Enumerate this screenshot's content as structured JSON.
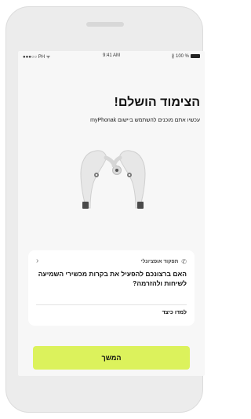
{
  "status_bar": {
    "carrier": "●●●○○ PH ᯤ",
    "time": "9:41 AM",
    "bluetooth": "∦",
    "battery": "100 %"
  },
  "screen": {
    "title": "הצימוד הושלם!",
    "subtitle": "עכשיו אתם מוכנים להשתמש ביישום myPhonak"
  },
  "card": {
    "label": "תפקוד אופציונלי",
    "question": "האם ברצונכם להפעיל את בקרות מכשירי השמיעה לשיחות ולהזרמה?",
    "link": "למדו כיצד",
    "chevron": "›"
  },
  "continue_button": {
    "label": "המשך"
  },
  "icons": {
    "card_icon": "phone-call-icon",
    "card_chevron": "chevron-icon",
    "illustration": "hearing-aids"
  },
  "colors": {
    "accent": "#dcf25c",
    "screen_bg": "#f7f7f7",
    "device_bg": "#ececec"
  }
}
